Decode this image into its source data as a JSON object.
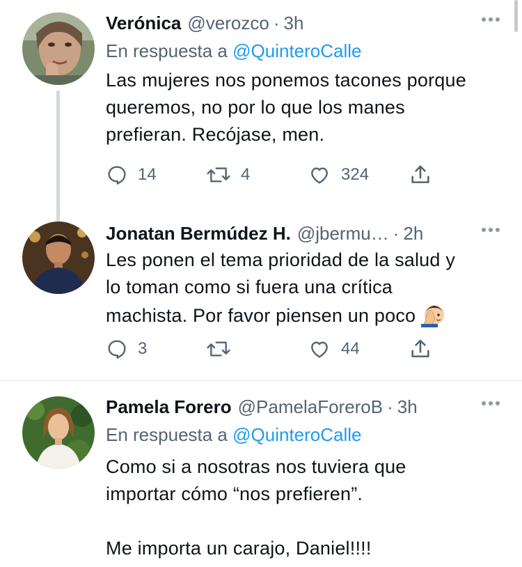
{
  "tweets": [
    {
      "name": "Verónica",
      "handle": "@verozco",
      "separator": "·",
      "time": "3h",
      "reply_prefix": "En respuesta a",
      "reply_to": "@QuinteroCalle",
      "lines": [
        "Las mujeres nos ponemos tacones porque",
        "queremos, no por lo que los manes",
        "prefieran. Recójase, men."
      ],
      "replies": "14",
      "retweets": "4",
      "likes": "324"
    },
    {
      "name": "Jonatan Bermúdez H.",
      "handle": "@jbermu…",
      "separator": "·",
      "time": "2h",
      "lines": [
        "Les ponen el tema prioridad de la salud y",
        "lo toman como si fuera una crítica",
        "machista. Por favor piensen un poco"
      ],
      "emoji": "face-palm-emoji",
      "replies": "3",
      "retweets": "",
      "likes": "44"
    },
    {
      "name": "Pamela Forero",
      "handle": "@PamelaForeroB",
      "separator": "·",
      "time": "3h",
      "reply_prefix": "En respuesta a",
      "reply_to": "@QuinteroCalle",
      "lines": [
        "Como si a nosotras nos tuviera que",
        "importar cómo “nos prefieren”.",
        "",
        "Me importa un carajo, Daniel!!!!"
      ]
    }
  ],
  "icons": [
    "more-icon",
    "reply-icon",
    "retweet-icon",
    "like-icon",
    "share-icon"
  ],
  "colors": {
    "text": "#0f1419",
    "secondary": "#536471",
    "link": "#1d9bf0",
    "thread_line": "#cfd9de",
    "divider": "#e3e8eb"
  }
}
